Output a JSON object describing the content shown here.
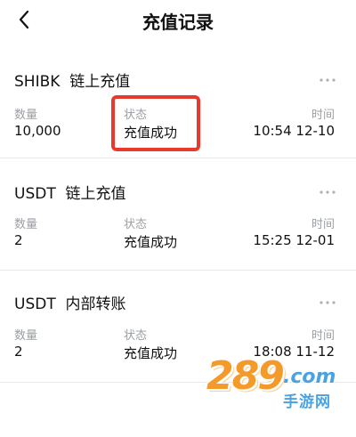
{
  "header": {
    "title": "充值记录",
    "back_icon": "chevron-left-icon"
  },
  "records": [
    {
      "title": "SHIBK  链上充值",
      "quantity_label": "数量",
      "quantity": "10,000",
      "status_label": "状态",
      "status": "充值成功",
      "time_label": "时间",
      "time": "10:54 12-10"
    },
    {
      "title": "USDT  链上充值",
      "quantity_label": "数量",
      "quantity": "2",
      "status_label": "状态",
      "status": "充值成功",
      "time_label": "时间",
      "time": "15:25 12-01"
    },
    {
      "title": "USDT  内部转账",
      "quantity_label": "数量",
      "quantity": "2",
      "status_label": "状态",
      "status": "充值成功",
      "time_label": "时间",
      "time": "18:08 11-12"
    }
  ],
  "more_icon": "more-dots-icon",
  "highlight_color": "#e83a2c",
  "watermark": {
    "numbers": "289",
    "domain": ".com",
    "cn": "手游网"
  }
}
